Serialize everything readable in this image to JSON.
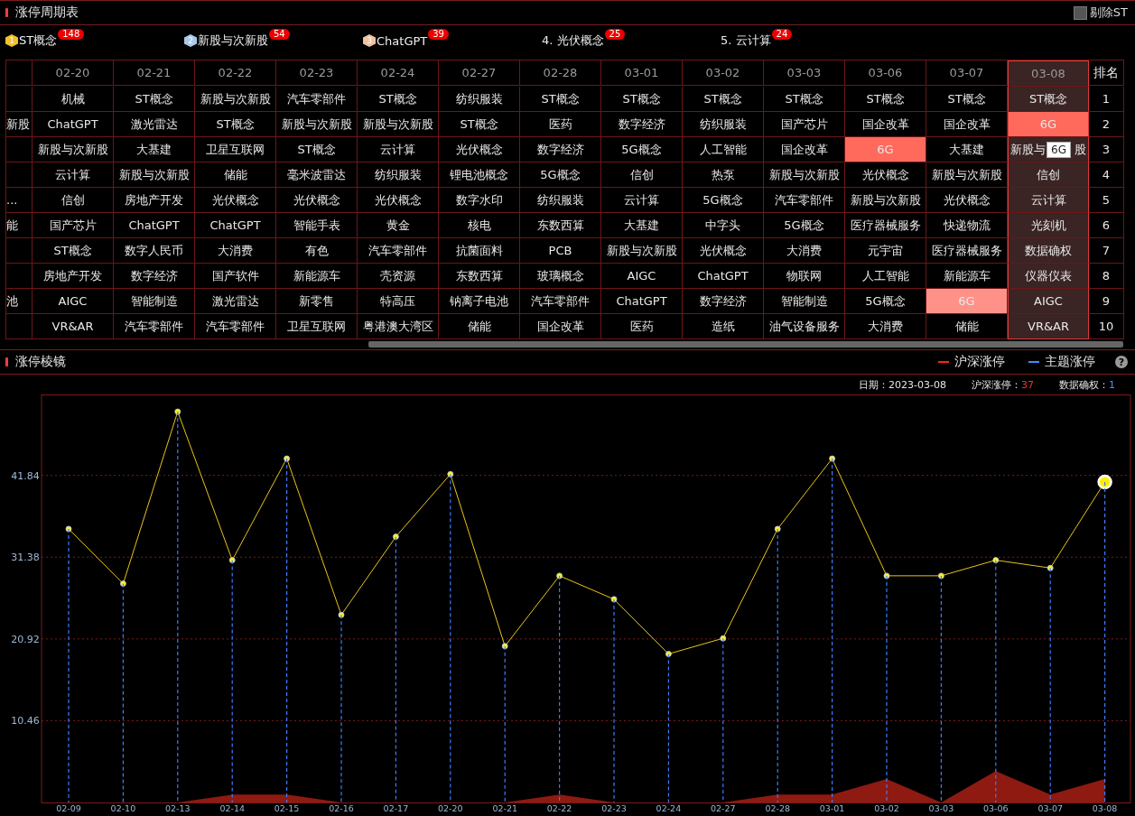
{
  "cycle_panel": {
    "title": "涨停周期表",
    "exclude_st": {
      "label": "剔除ST",
      "checked": false
    }
  },
  "top_themes": [
    {
      "kind": "medal",
      "rank": "1",
      "color": "#f2c12e",
      "label": "ST概念",
      "count": "148"
    },
    {
      "kind": "medal",
      "rank": "2",
      "color": "#a9c8ec",
      "label": "新股与次新股",
      "count": "54"
    },
    {
      "kind": "medal",
      "rank": "3",
      "color": "#efc3a0",
      "label": "ChatGPT",
      "count": "39"
    },
    {
      "kind": "plain",
      "label": "4. 光伏概念",
      "count": "25"
    },
    {
      "kind": "plain",
      "label": "5. 云计算",
      "count": "24"
    }
  ],
  "table": {
    "columns": [
      {
        "label": "02-20",
        "selected": false
      },
      {
        "label": "02-21",
        "selected": false
      },
      {
        "label": "02-22",
        "selected": false
      },
      {
        "label": "02-23",
        "selected": false
      },
      {
        "label": "02-24",
        "selected": false
      },
      {
        "label": "02-27",
        "selected": false
      },
      {
        "label": "02-28",
        "selected": false
      },
      {
        "label": "03-01",
        "selected": false
      },
      {
        "label": "03-02",
        "selected": false
      },
      {
        "label": "03-03",
        "selected": false
      },
      {
        "label": "03-06",
        "selected": false
      },
      {
        "label": "03-07",
        "selected": false
      },
      {
        "label": "03-08",
        "selected": true
      }
    ],
    "rank_header": "排名",
    "rows": [
      {
        "cells": [
          "机械",
          "ST概念",
          "新股与次新股",
          "汽车零部件",
          "ST概念",
          "纺织服装",
          "ST概念",
          "ST概念",
          "ST概念",
          "ST概念",
          "ST概念",
          "ST概念",
          "ST概念"
        ],
        "rank": "1"
      },
      {
        "cut": "新股",
        "cells": [
          "ChatGPT",
          "激光雷达",
          "ST概念",
          "新股与次新股",
          "新股与次新股",
          "ST概念",
          "医药",
          "数字经济",
          "纺织服装",
          "国产芯片",
          "国企改革",
          "国企改革",
          {
            "text": "6G",
            "color": "#ff6a5c"
          }
        ],
        "rank": "2"
      },
      {
        "cells": [
          "新股与次新股",
          "大基建",
          "卫星互联网",
          "ST概念",
          "云计算",
          "光伏概念",
          "数字经济",
          "5G概念",
          "人工智能",
          "国企改革",
          {
            "text": "6G",
            "color": "#ff6a5c"
          },
          "大基建",
          {
            "text": "新股与",
            "text_after": "股",
            "tooltip": "6G"
          }
        ],
        "rank": "3"
      },
      {
        "cells": [
          "云计算",
          "新股与次新股",
          "储能",
          "毫米波雷达",
          "纺织服装",
          "锂电池概念",
          "5G概念",
          "信创",
          "热泵",
          "新股与次新股",
          "光伏概念",
          "新股与次新股",
          "信创"
        ],
        "rank": "4"
      },
      {
        "cut": "...",
        "cells": [
          "信创",
          "房地产开发",
          "光伏概念",
          "光伏概念",
          "光伏概念",
          "数字水印",
          "纺织服装",
          "云计算",
          "5G概念",
          "汽车零部件",
          "新股与次新股",
          "光伏概念",
          "云计算"
        ],
        "rank": "5"
      },
      {
        "cut": "能",
        "cells": [
          "国产芯片",
          "ChatGPT",
          "ChatGPT",
          "智能手表",
          "黄金",
          "核电",
          "东数西算",
          "大基建",
          "中字头",
          "5G概念",
          "医疗器械服务",
          "快递物流",
          "光刻机"
        ],
        "rank": "6"
      },
      {
        "cells": [
          "ST概念",
          "数字人民币",
          "大消费",
          "有色",
          "汽车零部件",
          "抗菌面料",
          "PCB",
          "新股与次新股",
          "光伏概念",
          "大消费",
          "元宇宙",
          "医疗器械服务",
          "数据确权"
        ],
        "rank": "7"
      },
      {
        "cells": [
          "房地产开发",
          "数字经济",
          "国产软件",
          "新能源车",
          "壳资源",
          "东数西算",
          "玻璃概念",
          "AIGC",
          "ChatGPT",
          "物联网",
          "人工智能",
          "新能源车",
          "仪器仪表"
        ],
        "rank": "8"
      },
      {
        "cut": "池",
        "cells": [
          "AIGC",
          "智能制造",
          "激光雷达",
          "新零售",
          "特高压",
          "钠离子电池",
          "汽车零部件",
          "ChatGPT",
          "数字经济",
          "智能制造",
          "5G概念",
          {
            "text": "6G",
            "color": "#ff9288"
          },
          "AIGC"
        ],
        "rank": "9"
      },
      {
        "cells": [
          "VR&AR",
          "汽车零部件",
          "汽车零部件",
          "卫星互联网",
          "粤港澳大湾区",
          "储能",
          "国企改革",
          "医药",
          "造纸",
          "油气设备服务",
          "大消费",
          "储能",
          "VR&AR"
        ],
        "rank": "10"
      }
    ]
  },
  "prism_panel": {
    "title": "涨停棱镜",
    "legend": [
      {
        "color": "#ff2020"
      },
      {
        "color": "#3d8bff"
      }
    ],
    "help": "?",
    "info": {
      "date_label": "日期：",
      "date": "2023-03-08",
      "market_label": "沪深涨停：",
      "market_value": "37",
      "confirm_label": "数据确权：",
      "confirm_value": "1"
    },
    "chart_data": {
      "type": "line",
      "categories": [
        "02-09",
        "02-10",
        "02-13",
        "02-14",
        "02-15",
        "02-16",
        "02-17",
        "02-20",
        "02-21",
        "02-22",
        "02-23",
        "02-24",
        "02-27",
        "02-28",
        "03-01",
        "03-02",
        "03-03",
        "03-06",
        "03-07",
        "03-08"
      ],
      "series": [
        {
          "name": "沪深涨停",
          "type": "area",
          "color": "#8e1a12",
          "values": [
            0,
            0,
            0,
            1,
            1,
            0,
            0,
            0,
            0,
            1,
            0,
            0,
            0,
            1,
            1,
            3,
            0,
            4,
            1,
            3
          ]
        },
        {
          "name": "主题涨停",
          "type": "bar",
          "color": "#3d7cff",
          "values": [
            35,
            28,
            50,
            31,
            44,
            24,
            34,
            42,
            20,
            29,
            26,
            19,
            21,
            35,
            44,
            29,
            29,
            31,
            30,
            41
          ]
        },
        {
          "type": "line",
          "marker": true,
          "color": "#e8c51a",
          "values": [
            35,
            28,
            50,
            31,
            44,
            24,
            34,
            42,
            20,
            29,
            26,
            19,
            21,
            35,
            44,
            29,
            29,
            31,
            30,
            41
          ]
        }
      ],
      "grid": true,
      "ylim": [
        0,
        52.2
      ],
      "yticks": [
        10.46,
        20.92,
        31.38,
        41.84
      ]
    }
  }
}
